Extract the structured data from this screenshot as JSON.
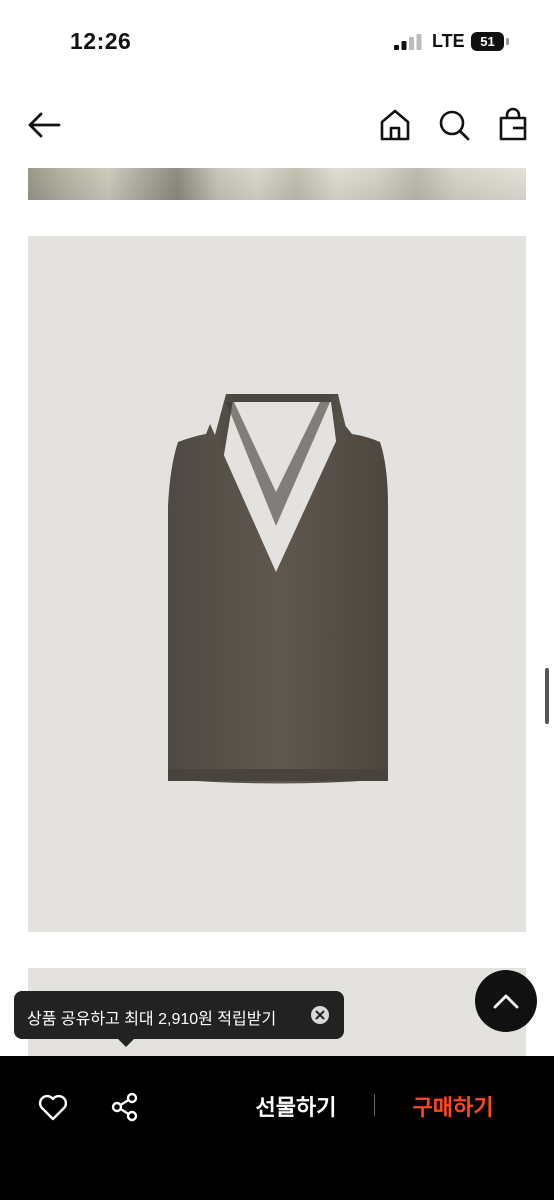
{
  "status_bar": {
    "time": "12:26",
    "network": "LTE",
    "battery_level": "51"
  },
  "nav": {
    "back_icon": "arrow-left-icon",
    "home_icon": "home-icon",
    "search_icon": "search-icon",
    "cart_icon": "shopping-bag-icon"
  },
  "tooltip": {
    "text": "상품 공유하고 최대 2,910원 적립받기",
    "close_icon": "close-circle-icon"
  },
  "action_bar": {
    "like_icon": "heart-icon",
    "share_icon": "share-icon",
    "gift_label": "선물하기",
    "buy_label": "구매하기"
  },
  "colors": {
    "buy_accent": "#ff4a1c",
    "action_bar_bg": "#000000",
    "photo_bg": "#e4e2de",
    "garment": "#5b554d"
  }
}
